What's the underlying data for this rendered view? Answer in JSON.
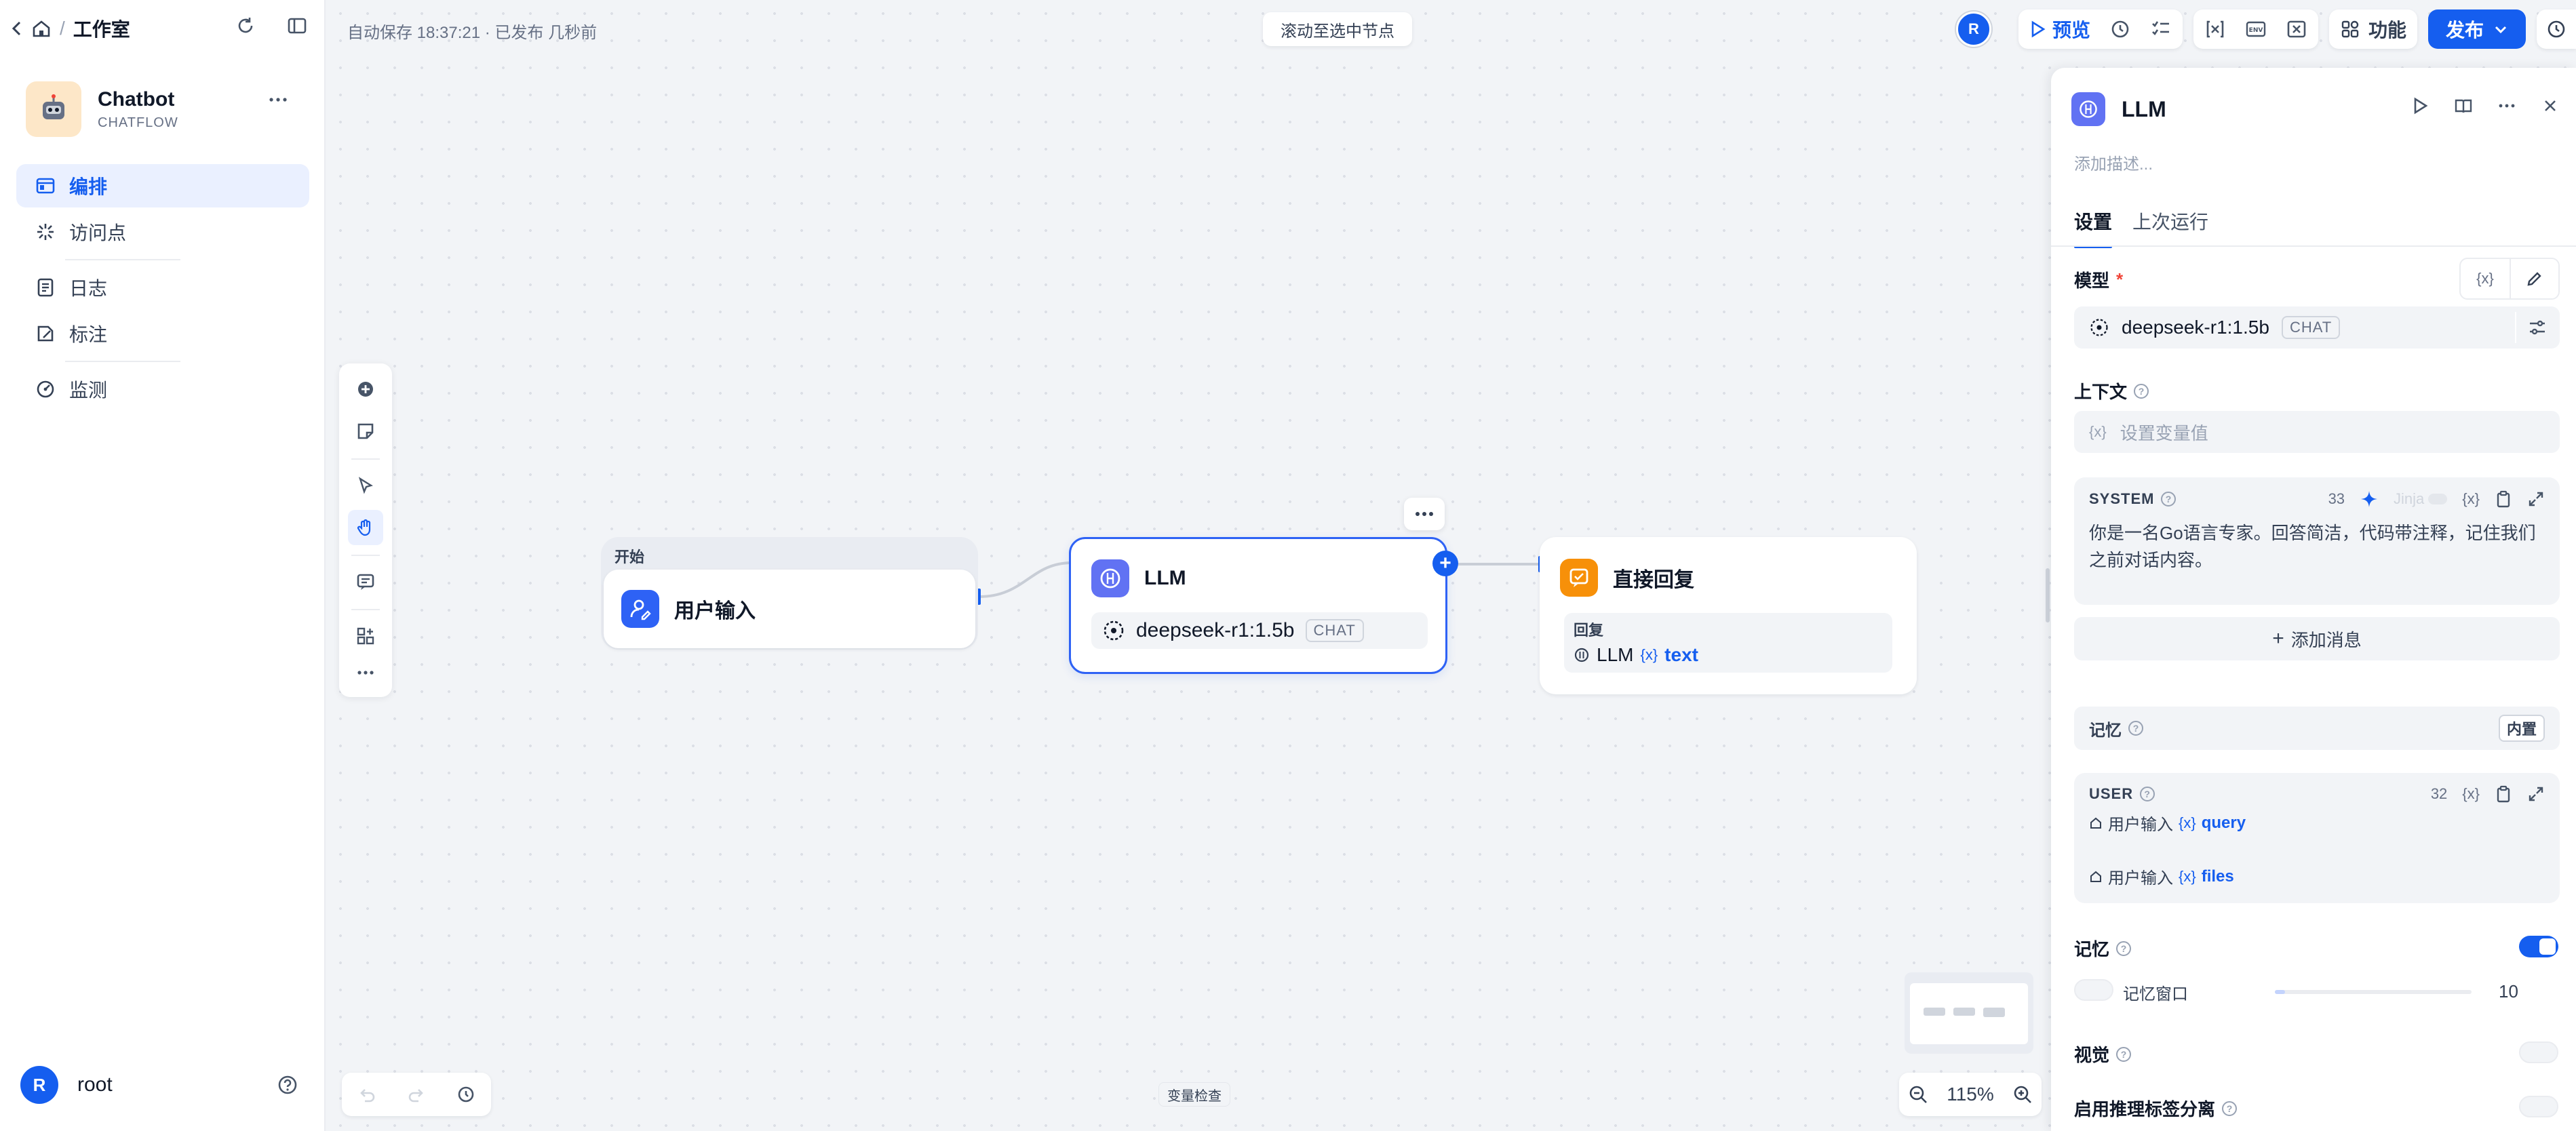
{
  "breadcrumb": {
    "workspace": "工作室"
  },
  "app": {
    "name": "Chatbot",
    "type": "CHATFLOW"
  },
  "sidebar": {
    "items": [
      {
        "label": "编排",
        "icon": "layout-icon",
        "active": true
      },
      {
        "label": "访问点",
        "icon": "api-icon",
        "active": false
      },
      {
        "label": "日志",
        "icon": "log-icon",
        "active": false
      },
      {
        "label": "标注",
        "icon": "annotation-icon",
        "active": false
      },
      {
        "label": "监测",
        "icon": "monitor-icon",
        "active": false
      }
    ],
    "user": {
      "initial": "R",
      "name": "root"
    }
  },
  "header": {
    "autosave": "自动保存 18:37:21 · 已发布 几秒前",
    "scroll_to_selected": "滚动至选中节点",
    "avatar_initial": "R",
    "preview": "预览",
    "features": "功能",
    "publish": "发布"
  },
  "nodes": {
    "start": {
      "group_label": "开始",
      "title": "用户输入"
    },
    "llm": {
      "title": "LLM",
      "model": "deepseek-r1:1.5b",
      "model_tag": "CHAT"
    },
    "reply": {
      "title": "直接回复",
      "field_label": "回复",
      "source": "LLM",
      "var": "text"
    }
  },
  "bottom": {
    "variable_inspect": "变量检查",
    "zoom": "115%"
  },
  "panel": {
    "title": "LLM",
    "description_placeholder": "添加描述...",
    "tabs": [
      "设置",
      "上次运行"
    ],
    "model_label": "模型",
    "model_name": "deepseek-r1:1.5b",
    "model_tag": "CHAT",
    "context_label": "上下文",
    "context_placeholder": "设置变量值",
    "system": {
      "role": "SYSTEM",
      "count": "33",
      "jinja": "Jinja",
      "text": "你是一名Go语言专家。回答简洁，代码带注释，记住我们之前对话内容。"
    },
    "add_message": "添加消息",
    "memory_row": {
      "label": "记忆",
      "badge": "内置"
    },
    "user_msg": {
      "role": "USER",
      "count": "32",
      "vars": [
        {
          "source": "用户输入",
          "name": "query"
        },
        {
          "source": "用户输入",
          "name": "files"
        }
      ]
    },
    "memory_label": "记忆",
    "memory_window_label": "记忆窗口",
    "memory_window_value": "10",
    "memory_window_fraction": 0.05,
    "vision_label": "视觉",
    "reasoning_label": "启用推理标签分离"
  },
  "colors": {
    "accent": "#155eef",
    "start_icon": "#2e62f5",
    "llm_icon": "#6172f3",
    "reply_icon": "#f79009"
  }
}
